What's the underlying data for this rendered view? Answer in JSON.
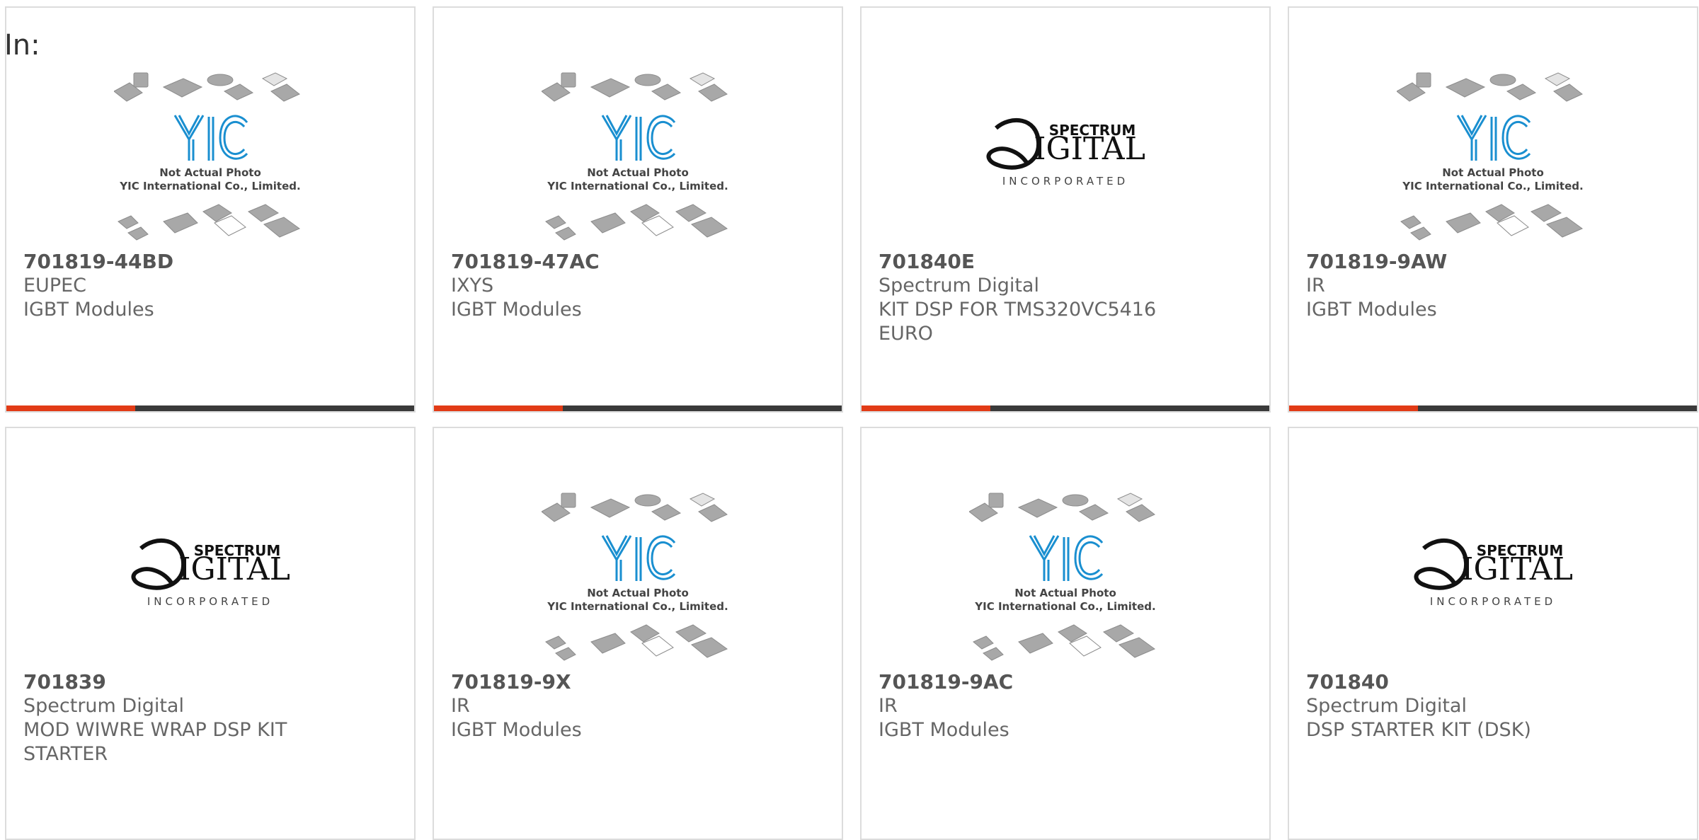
{
  "header": {
    "in_label": "In:"
  },
  "products": [
    {
      "part_number": "701819-44BD",
      "manufacturer": "EUPEC",
      "description": "IGBT Modules",
      "image": "yic-placeholder",
      "image_text_1": "Not Actual Photo",
      "image_text_2": "YIC International Co., Limited."
    },
    {
      "part_number": "701819-47AC",
      "manufacturer": "IXYS",
      "description": "IGBT Modules",
      "image": "yic-placeholder",
      "image_text_1": "Not Actual Photo",
      "image_text_2": "YIC International Co., Limited."
    },
    {
      "part_number": "701840E",
      "manufacturer": "Spectrum Digital",
      "description": "KIT DSP FOR TMS320VC5416 EURO",
      "image": "spectrum-digital-logo",
      "logo_top": "SPECTRUM",
      "logo_main": "IGITAL",
      "logo_sub": "INCORPORATED"
    },
    {
      "part_number": "701819-9AW",
      "manufacturer": "IR",
      "description": "IGBT Modules",
      "image": "yic-placeholder",
      "image_text_1": "Not Actual Photo",
      "image_text_2": "YIC International Co., Limited."
    },
    {
      "part_number": "701839",
      "manufacturer": "Spectrum Digital",
      "description": "MOD WIWRE WRAP DSP KIT STARTER",
      "image": "spectrum-digital-logo",
      "logo_top": "SPECTRUM",
      "logo_main": "IGITAL",
      "logo_sub": "INCORPORATED"
    },
    {
      "part_number": "701819-9X",
      "manufacturer": "IR",
      "description": "IGBT Modules",
      "image": "yic-placeholder",
      "image_text_1": "Not Actual Photo",
      "image_text_2": "YIC International Co., Limited."
    },
    {
      "part_number": "701819-9AC",
      "manufacturer": "IR",
      "description": "IGBT Modules",
      "image": "yic-placeholder",
      "image_text_1": "Not Actual Photo",
      "image_text_2": "YIC International Co., Limited."
    },
    {
      "part_number": "701840",
      "manufacturer": "Spectrum Digital",
      "description": "DSP STARTER KIT (DSK)",
      "image": "spectrum-digital-logo",
      "logo_top": "SPECTRUM",
      "logo_main": "IGITAL",
      "logo_sub": "INCORPORATED"
    }
  ],
  "colors": {
    "accent": "#e23b16",
    "bar": "#3a3a3a",
    "border": "#dcdcdc",
    "text": "#666666",
    "yic_blue": "#1a8fd0"
  }
}
